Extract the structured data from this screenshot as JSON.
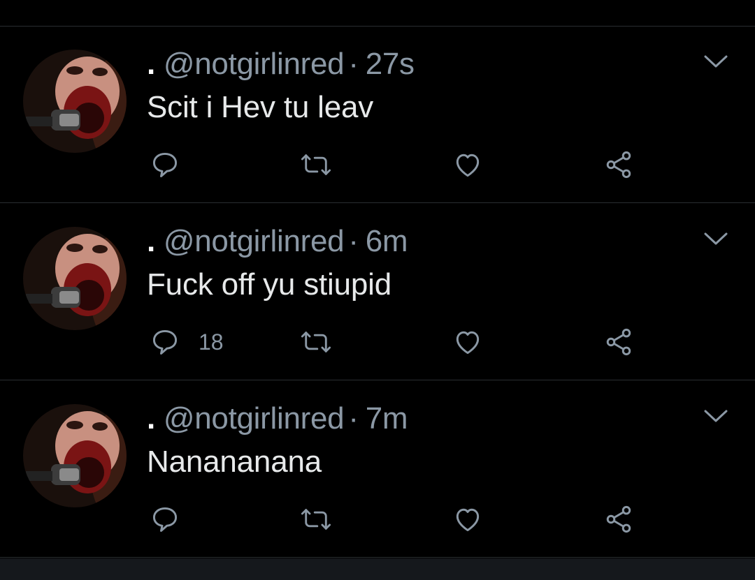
{
  "colors": {
    "background": "#000000",
    "divider": "#2a2e31",
    "muted_text": "#8b98a5",
    "body_text": "#e7e9ea"
  },
  "tweets": [
    {
      "display_name": ".",
      "handle": "@notgirlinred",
      "separator": "·",
      "time": "27s",
      "text": "Scit i Hev tu leav",
      "reply_count": "",
      "icons": [
        "reply-icon",
        "retweet-icon",
        "like-icon",
        "share-icon",
        "chevron-down-icon"
      ]
    },
    {
      "display_name": ".",
      "handle": "@notgirlinred",
      "separator": "·",
      "time": "6m",
      "text": "Fuck off yu stiupid",
      "reply_count": "18",
      "icons": [
        "reply-icon",
        "retweet-icon",
        "like-icon",
        "share-icon",
        "chevron-down-icon"
      ]
    },
    {
      "display_name": ".",
      "handle": "@notgirlinred",
      "separator": "·",
      "time": "7m",
      "text": "Nanananana",
      "reply_count": "",
      "icons": [
        "reply-icon",
        "retweet-icon",
        "like-icon",
        "share-icon",
        "chevron-down-icon"
      ]
    }
  ]
}
